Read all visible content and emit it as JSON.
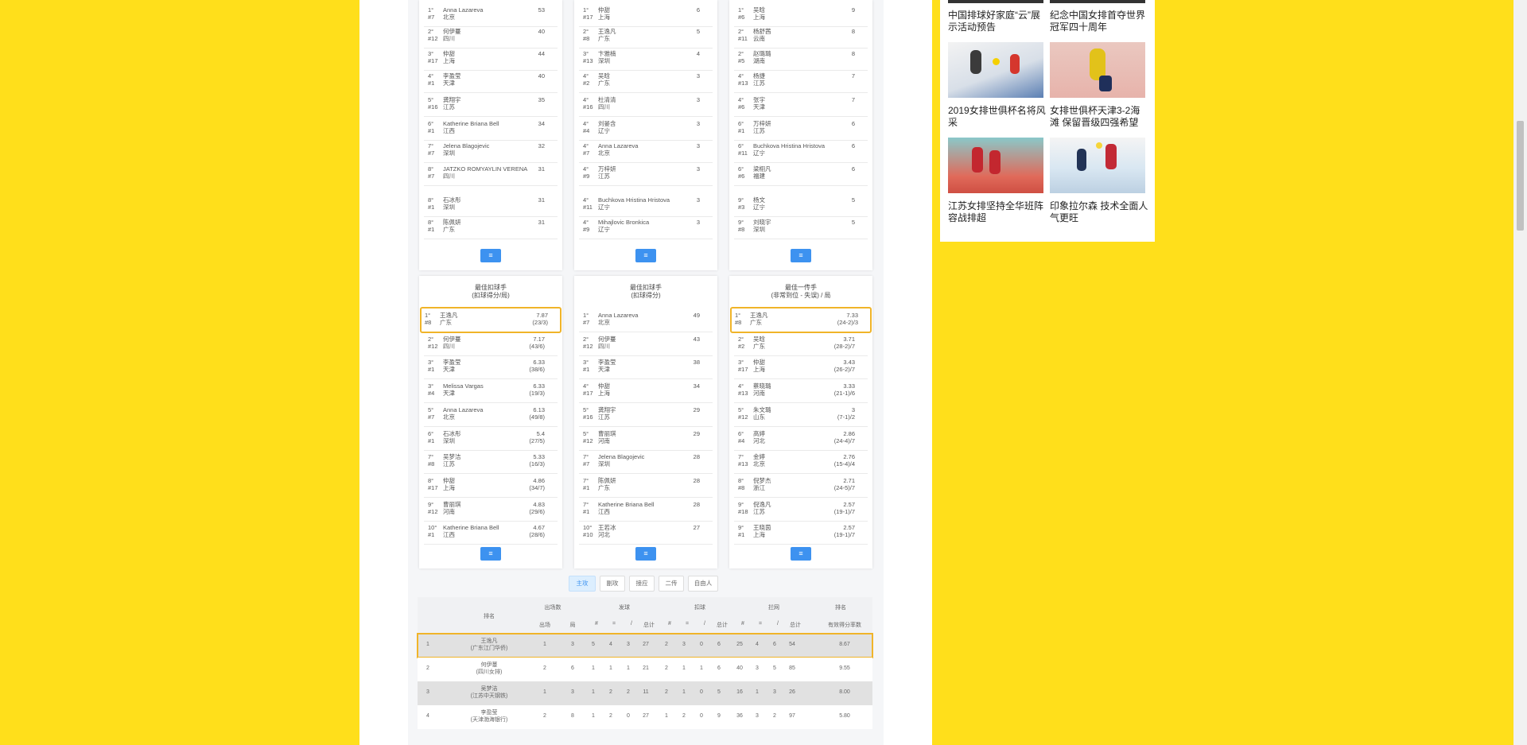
{
  "colors": {
    "background": "#ffdf1b",
    "accent": "#3d92f0",
    "highlight": "#f0b429"
  },
  "more_label": "≡",
  "top_panels": [
    {
      "rows": [
        {
          "rank": "1°",
          "num": "#7",
          "name": "Anna Lazareva",
          "team": "北京",
          "value": "53",
          "sub": ""
        },
        {
          "rank": "2°",
          "num": "#12",
          "name": "何伊蔓",
          "team": "四川",
          "value": "40",
          "sub": ""
        },
        {
          "rank": "3°",
          "num": "#17",
          "name": "仲甜",
          "team": "上海",
          "value": "44",
          "sub": ""
        },
        {
          "rank": "4°",
          "num": "#1",
          "name": "李盈莹",
          "team": "天津",
          "value": "40",
          "sub": ""
        },
        {
          "rank": "5°",
          "num": "#16",
          "name": "龚翔宇",
          "team": "江苏",
          "value": "35",
          "sub": ""
        },
        {
          "rank": "6°",
          "num": "#1",
          "name": "Katherine Briana Bell",
          "team": "江西",
          "value": "34",
          "sub": ""
        },
        {
          "rank": "7°",
          "num": "#7",
          "name": "Jelena Blagojevic",
          "team": "深圳",
          "value": "32",
          "sub": ""
        },
        {
          "rank": "8°",
          "num": "#7",
          "name": "JATZKO ROMYAYLIN VERENA",
          "team": "四川",
          "value": "31",
          "sub": ""
        },
        {
          "rank": "8°",
          "num": "#1",
          "name": "石冰彤",
          "team": "深圳",
          "value": "31",
          "sub": ""
        },
        {
          "rank": "8°",
          "num": "#1",
          "name": "陈佩妍",
          "team": "广东",
          "value": "31",
          "sub": ""
        }
      ]
    },
    {
      "rows": [
        {
          "rank": "1°",
          "num": "#17",
          "name": "仲甜",
          "team": "上海",
          "value": "6",
          "sub": ""
        },
        {
          "rank": "2°",
          "num": "#8",
          "name": "王逸凡",
          "team": "广东",
          "value": "5",
          "sub": ""
        },
        {
          "rank": "3°",
          "num": "#13",
          "name": "卞雅楠",
          "team": "深圳",
          "value": "4",
          "sub": ""
        },
        {
          "rank": "4°",
          "num": "#2",
          "name": "吴晗",
          "team": "广东",
          "value": "3",
          "sub": ""
        },
        {
          "rank": "4°",
          "num": "#16",
          "name": "杜清清",
          "team": "四川",
          "value": "3",
          "sub": ""
        },
        {
          "rank": "4°",
          "num": "#4",
          "name": "刘晏含",
          "team": "辽宁",
          "value": "3",
          "sub": ""
        },
        {
          "rank": "4°",
          "num": "#7",
          "name": "Anna Lazareva",
          "team": "北京",
          "value": "3",
          "sub": ""
        },
        {
          "rank": "4°",
          "num": "#9",
          "name": "万梓妍",
          "team": "江苏",
          "value": "3",
          "sub": ""
        },
        {
          "rank": "4°",
          "num": "#11",
          "name": "Buchkova Hristina Hristova",
          "team": "辽宁",
          "value": "3",
          "sub": ""
        },
        {
          "rank": "4°",
          "num": "#9",
          "name": "Mihajlovic Bronkica",
          "team": "辽宁",
          "value": "3",
          "sub": ""
        }
      ]
    },
    {
      "rows": [
        {
          "rank": "1°",
          "num": "#6",
          "name": "吴晗",
          "team": "上海",
          "value": "9",
          "sub": ""
        },
        {
          "rank": "2°",
          "num": "#11",
          "name": "杨舒茜",
          "team": "云南",
          "value": "8",
          "sub": ""
        },
        {
          "rank": "2°",
          "num": "#5",
          "name": "赵璐璐",
          "team": "湖南",
          "value": "8",
          "sub": ""
        },
        {
          "rank": "4°",
          "num": "#13",
          "name": "杨捷",
          "team": "江苏",
          "value": "7",
          "sub": ""
        },
        {
          "rank": "4°",
          "num": "#6",
          "name": "张宇",
          "team": "天津",
          "value": "7",
          "sub": ""
        },
        {
          "rank": "6°",
          "num": "#1",
          "name": "万梓妍",
          "team": "江苏",
          "value": "6",
          "sub": ""
        },
        {
          "rank": "6°",
          "num": "#11",
          "name": "Buchkova Hristina Hristova",
          "team": "辽宁",
          "value": "6",
          "sub": ""
        },
        {
          "rank": "6°",
          "num": "#6",
          "name": "梁栩凡",
          "team": "福建",
          "value": "6",
          "sub": ""
        },
        {
          "rank": "9°",
          "num": "#3",
          "name": "杨文",
          "team": "辽宁",
          "value": "5",
          "sub": ""
        },
        {
          "rank": "9°",
          "num": "#8",
          "name": "刘晓宇",
          "team": "深圳",
          "value": "5",
          "sub": ""
        }
      ]
    }
  ],
  "bottom_panels": [
    {
      "title": "最佳扣球手",
      "subtitle": "(扣球得分/局)",
      "rows": [
        {
          "rank": "1°",
          "num": "#8",
          "name": "王逸凡",
          "team": "广东",
          "value": "7.87",
          "sub": "(23/3)"
        },
        {
          "rank": "2°",
          "num": "#12",
          "name": "何伊蔓",
          "team": "四川",
          "value": "7.17",
          "sub": "(43/6)"
        },
        {
          "rank": "3°",
          "num": "#1",
          "name": "李盈莹",
          "team": "天津",
          "value": "6.33",
          "sub": "(38/6)"
        },
        {
          "rank": "3°",
          "num": "#4",
          "name": "Melissa Vargas",
          "team": "天津",
          "value": "6.33",
          "sub": "(19/3)"
        },
        {
          "rank": "5°",
          "num": "#7",
          "name": "Anna Lazareva",
          "team": "北京",
          "value": "6.13",
          "sub": "(49/8)"
        },
        {
          "rank": "6°",
          "num": "#1",
          "name": "石冰彤",
          "team": "深圳",
          "value": "5.4",
          "sub": "(27/5)"
        },
        {
          "rank": "7°",
          "num": "#8",
          "name": "吴梦洁",
          "team": "江苏",
          "value": "5.33",
          "sub": "(16/3)"
        },
        {
          "rank": "8°",
          "num": "#17",
          "name": "仲甜",
          "team": "上海",
          "value": "4.86",
          "sub": "(34/7)"
        },
        {
          "rank": "9°",
          "num": "#12",
          "name": "曹丽琪",
          "team": "河南",
          "value": "4.83",
          "sub": "(29/6)"
        },
        {
          "rank": "10°",
          "num": "#1",
          "name": "Katherine Briana Bell",
          "team": "江西",
          "value": "4.67",
          "sub": "(28/6)"
        }
      ]
    },
    {
      "title": "最佳扣球手",
      "subtitle": "(扣球得分)",
      "rows": [
        {
          "rank": "1°",
          "num": "#7",
          "name": "Anna Lazareva",
          "team": "北京",
          "value": "49",
          "sub": ""
        },
        {
          "rank": "2°",
          "num": "#12",
          "name": "何伊蔓",
          "team": "四川",
          "value": "43",
          "sub": ""
        },
        {
          "rank": "3°",
          "num": "#1",
          "name": "李盈莹",
          "team": "天津",
          "value": "38",
          "sub": ""
        },
        {
          "rank": "4°",
          "num": "#17",
          "name": "仲甜",
          "team": "上海",
          "value": "34",
          "sub": ""
        },
        {
          "rank": "5°",
          "num": "#16",
          "name": "龚翔宇",
          "team": "江苏",
          "value": "29",
          "sub": ""
        },
        {
          "rank": "5°",
          "num": "#12",
          "name": "曹丽琪",
          "team": "河南",
          "value": "29",
          "sub": ""
        },
        {
          "rank": "7°",
          "num": "#7",
          "name": "Jelena Blagojevic",
          "team": "深圳",
          "value": "28",
          "sub": ""
        },
        {
          "rank": "7°",
          "num": "#1",
          "name": "陈佩妍",
          "team": "广东",
          "value": "28",
          "sub": ""
        },
        {
          "rank": "7°",
          "num": "#1",
          "name": "Katherine Briana Bell",
          "team": "江西",
          "value": "28",
          "sub": ""
        },
        {
          "rank": "10°",
          "num": "#10",
          "name": "王若冰",
          "team": "河北",
          "value": "27",
          "sub": ""
        }
      ]
    },
    {
      "title": "最佳一传手",
      "subtitle": "(非常到位 - 失误) / 局",
      "rows": [
        {
          "rank": "1°",
          "num": "#8",
          "name": "王逸凡",
          "team": "广东",
          "value": "7.33",
          "sub": "(24-2)/3"
        },
        {
          "rank": "2°",
          "num": "#2",
          "name": "吴晗",
          "team": "广东",
          "value": "3.71",
          "sub": "(28-2)/7"
        },
        {
          "rank": "3°",
          "num": "#17",
          "name": "仲甜",
          "team": "上海",
          "value": "3.43",
          "sub": "(26-2)/7"
        },
        {
          "rank": "4°",
          "num": "#13",
          "name": "蔡晓璐",
          "team": "河南",
          "value": "3.33",
          "sub": "(21-1)/6"
        },
        {
          "rank": "5°",
          "num": "#12",
          "name": "朱文璐",
          "team": "山东",
          "value": "3",
          "sub": "(7-1)/2"
        },
        {
          "rank": "6°",
          "num": "#4",
          "name": "高婷",
          "team": "河北",
          "value": "2.86",
          "sub": "(24-4)/7"
        },
        {
          "rank": "7°",
          "num": "#13",
          "name": "金婷",
          "team": "北京",
          "value": "2.76",
          "sub": "(15-4)/4"
        },
        {
          "rank": "8°",
          "num": "#8",
          "name": "倪梦杰",
          "team": "浙江",
          "value": "2.71",
          "sub": "(24-5)/7"
        },
        {
          "rank": "9°",
          "num": "#18",
          "name": "倪逸凡",
          "team": "江苏",
          "value": "2.57",
          "sub": "(19-1)/7"
        },
        {
          "rank": "9°",
          "num": "#1",
          "name": "王晓茵",
          "team": "上海",
          "value": "2.57",
          "sub": "(19-1)/7"
        }
      ]
    }
  ],
  "tabs": [
    "主攻",
    "副攻",
    "接应",
    "二传",
    "自由人"
  ],
  "table": {
    "col_rank": "排名",
    "groups": [
      "出场数",
      "发球",
      "扣球",
      "拦网",
      "排名"
    ],
    "subs": [
      "出场",
      "局",
      "#",
      "=",
      "/",
      "总计",
      "#",
      "=",
      "/",
      "总计",
      "#",
      "=",
      "/",
      "总计",
      "有效得分率数"
    ],
    "rows": [
      {
        "rank": "1",
        "name": "王逸凡",
        "team": "(广东江门华侨)",
        "cells": [
          "1",
          "3",
          "5",
          "4",
          "3",
          "27",
          "2",
          "3",
          "0",
          "6",
          "25",
          "4",
          "6",
          "54",
          "8.67"
        ]
      },
      {
        "rank": "2",
        "name": "何伊蔓",
        "team": "(四川女排)",
        "cells": [
          "2",
          "6",
          "1",
          "1",
          "1",
          "21",
          "2",
          "1",
          "1",
          "6",
          "40",
          "3",
          "5",
          "85",
          "9.55"
        ]
      },
      {
        "rank": "3",
        "name": "吴梦洁",
        "team": "(江苏中天钢铁)",
        "cells": [
          "1",
          "3",
          "1",
          "2",
          "2",
          "11",
          "2",
          "1",
          "0",
          "5",
          "16",
          "1",
          "3",
          "26",
          "8.00"
        ]
      },
      {
        "rank": "4",
        "name": "李盈莹",
        "team": "(天津渤海银行)",
        "cells": [
          "2",
          "8",
          "1",
          "2",
          "0",
          "27",
          "1",
          "2",
          "0",
          "9",
          "36",
          "3",
          "2",
          "97",
          "5.80"
        ]
      }
    ]
  },
  "news": [
    {
      "title": "中国排球好家庭“云”展示活动预告"
    },
    {
      "title": "纪念中国女排首夺世界冠军四十周年"
    },
    {
      "title": "2019女排世俱杯名将风采"
    },
    {
      "title": "女排世俱杯天津3-2海滩 保留晋级四强希望"
    },
    {
      "title": "江苏女排坚持全华班阵容战排超"
    },
    {
      "title": "印象拉尔森 技术全面人气更旺"
    }
  ]
}
